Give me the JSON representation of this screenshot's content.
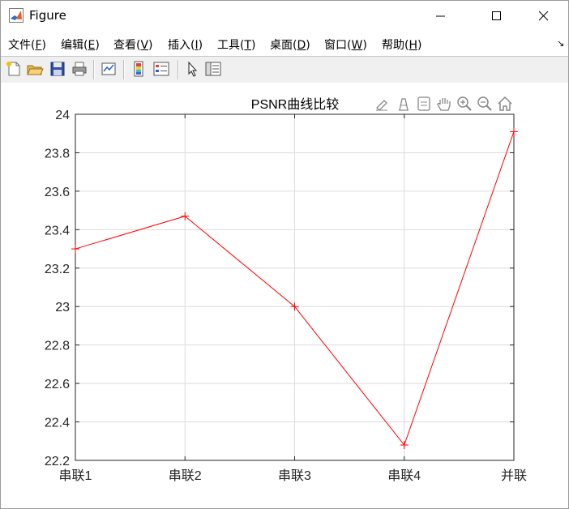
{
  "window": {
    "title": "Figure"
  },
  "menu": [
    {
      "label": "文件(",
      "key": "F",
      "tail": ")"
    },
    {
      "label": "编辑(",
      "key": "E",
      "tail": ")"
    },
    {
      "label": "查看(",
      "key": "V",
      "tail": ")"
    },
    {
      "label": "插入(",
      "key": "I",
      "tail": ")"
    },
    {
      "label": "工具(",
      "key": "T",
      "tail": ")"
    },
    {
      "label": "桌面(",
      "key": "D",
      "tail": ")"
    },
    {
      "label": "窗口(",
      "key": "W",
      "tail": ")"
    },
    {
      "label": "帮助(",
      "key": "H",
      "tail": ")"
    }
  ],
  "colors": {
    "line": "#ff0000",
    "grid": "#dcdcdc",
    "axis": "#262626"
  },
  "chart_data": {
    "type": "line",
    "title": "PSNR曲线比较",
    "categories": [
      "串联1",
      "串联2",
      "串联3",
      "串联4",
      "并联"
    ],
    "series": [
      {
        "values": [
          23.3,
          23.47,
          23.0,
          22.28,
          23.91
        ],
        "marker": "+",
        "color": "#ff0000"
      }
    ],
    "ylim": [
      22.2,
      24
    ],
    "yticks": [
      "22.2",
      "22.4",
      "22.6",
      "22.8",
      "23",
      "23.2",
      "23.4",
      "23.6",
      "23.8",
      "24"
    ],
    "grid": true,
    "legend": "none"
  }
}
